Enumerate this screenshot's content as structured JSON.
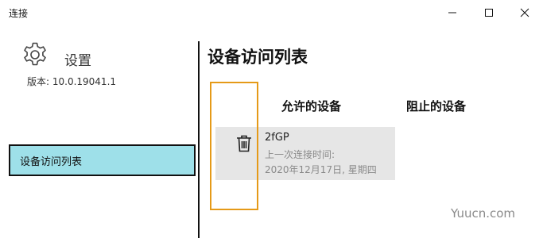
{
  "window": {
    "title": "连接"
  },
  "sidebar": {
    "settings_label": "设置",
    "version_text": "版本: 10.0.19041.1",
    "items": [
      {
        "label": "设备访问列表",
        "selected": true
      }
    ]
  },
  "main": {
    "page_title": "设备访问列表",
    "columns": {
      "allowed": "允许的设备",
      "blocked": "阻止的设备"
    },
    "devices": [
      {
        "name": "2fGP",
        "last_connected_label": "上一次连接时间:",
        "last_connected_time": "2020年12月17日, 星期四"
      }
    ]
  },
  "watermark": "Yuucn.com",
  "colors": {
    "nav_selected_bg": "#9ee0e9",
    "highlight_border": "#e59a18",
    "card_bg": "#e6e6e6"
  },
  "icons": {
    "minimize": "minimize-icon",
    "maximize": "maximize-icon",
    "close": "close-icon",
    "settings": "gear-icon",
    "delete": "trash-icon"
  }
}
